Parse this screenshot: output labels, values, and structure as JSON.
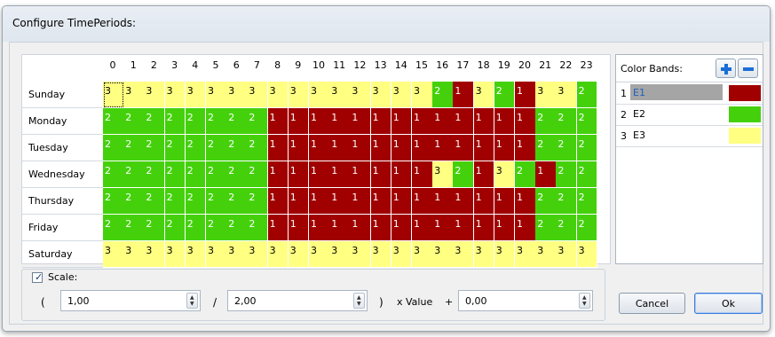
{
  "window": {
    "title": "Configure TimePeriods:"
  },
  "hours": [
    "0",
    "1",
    "2",
    "3",
    "4",
    "5",
    "6",
    "7",
    "8",
    "9",
    "10",
    "11",
    "12",
    "13",
    "14",
    "15",
    "16",
    "17",
    "18",
    "19",
    "20",
    "21",
    "22",
    "23"
  ],
  "days": [
    {
      "label": "Sunday",
      "values": [
        "3",
        "3",
        "3",
        "3",
        "3",
        "3",
        "3",
        "3",
        "3",
        "3",
        "3",
        "3",
        "3",
        "3",
        "3",
        "3",
        "2",
        "1",
        "3",
        "2",
        "1",
        "3",
        "3",
        "2"
      ]
    },
    {
      "label": "Monday",
      "values": [
        "2",
        "2",
        "2",
        "2",
        "2",
        "2",
        "2",
        "2",
        "1",
        "1",
        "1",
        "1",
        "1",
        "1",
        "1",
        "1",
        "1",
        "1",
        "1",
        "1",
        "1",
        "2",
        "2",
        "2"
      ]
    },
    {
      "label": "Tuesday",
      "values": [
        "2",
        "2",
        "2",
        "2",
        "2",
        "2",
        "2",
        "2",
        "1",
        "1",
        "1",
        "1",
        "1",
        "1",
        "1",
        "1",
        "1",
        "1",
        "1",
        "1",
        "1",
        "2",
        "2",
        "2"
      ]
    },
    {
      "label": "Wednesday",
      "values": [
        "2",
        "2",
        "2",
        "2",
        "2",
        "2",
        "2",
        "2",
        "1",
        "1",
        "1",
        "1",
        "1",
        "1",
        "1",
        "1",
        "3",
        "2",
        "1",
        "3",
        "2",
        "1",
        "2",
        "2"
      ]
    },
    {
      "label": "Thursday",
      "values": [
        "2",
        "2",
        "2",
        "2",
        "2",
        "2",
        "2",
        "2",
        "1",
        "1",
        "1",
        "1",
        "1",
        "1",
        "1",
        "1",
        "1",
        "1",
        "1",
        "1",
        "1",
        "2",
        "2",
        "2"
      ]
    },
    {
      "label": "Friday",
      "values": [
        "2",
        "2",
        "2",
        "2",
        "2",
        "2",
        "2",
        "2",
        "1",
        "1",
        "1",
        "1",
        "1",
        "1",
        "1",
        "1",
        "1",
        "1",
        "1",
        "1",
        "1",
        "2",
        "2",
        "2"
      ]
    },
    {
      "label": "Saturday",
      "values": [
        "3",
        "3",
        "3",
        "3",
        "3",
        "3",
        "3",
        "3",
        "3",
        "3",
        "3",
        "3",
        "3",
        "3",
        "3",
        "3",
        "3",
        "3",
        "3",
        "3",
        "3",
        "3",
        "3",
        "3"
      ]
    }
  ],
  "band_colors": {
    "1": "#a00000",
    "2": "#44d10c",
    "3": "#ffff82"
  },
  "color_bands": {
    "title": "Color Bands:",
    "add_icon": "plus-icon",
    "remove_icon": "minus-icon",
    "items": [
      {
        "index": "1",
        "name": "E1",
        "color": "#a00000",
        "selected": true
      },
      {
        "index": "2",
        "name": "E2",
        "color": "#44d10c",
        "selected": false
      },
      {
        "index": "3",
        "name": "E3",
        "color": "#ffff82",
        "selected": false
      }
    ]
  },
  "scale": {
    "checkbox_label": "Scale:",
    "checked": true,
    "open_paren": "(",
    "numerator": "1,00",
    "divider": "/",
    "denominator": "2,00",
    "close_paren": ")",
    "x_value": "x Value",
    "plus": "+",
    "offset": "0,00"
  },
  "buttons": {
    "cancel": "Cancel",
    "ok": "Ok"
  }
}
